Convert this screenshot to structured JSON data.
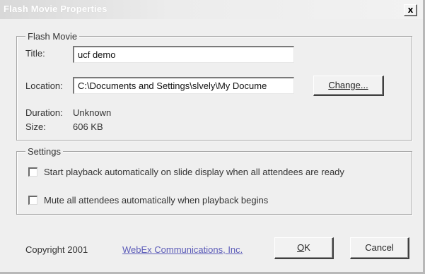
{
  "window": {
    "title": "Flash Movie Properties",
    "close_label": "x"
  },
  "flash_movie": {
    "group_label": "Flash Movie",
    "title_label": "Title:",
    "title_value": "ucf demo",
    "location_label": "Location:",
    "location_value": "C:\\Documents and Settings\\slvely\\My Docume",
    "change_button": "Change...",
    "duration_label": "Duration:",
    "duration_value": "Unknown",
    "size_label": "Size:",
    "size_value": "606 KB"
  },
  "settings": {
    "group_label": "Settings",
    "options": [
      {
        "label": "Start playback automatically on slide display when all attendees are ready",
        "checked": false
      },
      {
        "label": "Mute all attendees automatically when playback begins",
        "checked": false
      }
    ]
  },
  "footer": {
    "copyright": "Copyright 2001",
    "company_link": "WebEx Communications, Inc.",
    "ok_mnemonic": "O",
    "ok_rest": "K",
    "cancel_label": "Cancel"
  }
}
